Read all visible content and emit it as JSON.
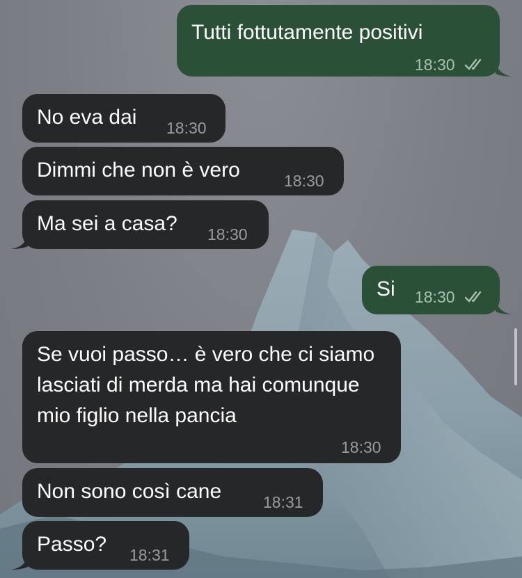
{
  "messages": [
    {
      "direction": "out",
      "text": "Tutti fottutamente positivi",
      "time": "18:30",
      "status": "read"
    },
    {
      "direction": "in",
      "text": "No eva dai",
      "time": "18:30"
    },
    {
      "direction": "in",
      "text": "Dimmi che non è vero",
      "time": "18:30"
    },
    {
      "direction": "in",
      "text": "Ma sei a casa?",
      "time": "18:30"
    },
    {
      "direction": "out",
      "text": "Si",
      "time": "18:30",
      "status": "read"
    },
    {
      "direction": "in",
      "text": "Se vuoi passo… è vero che ci siamo lasciati di merda ma hai comunque mio figlio nella pancia",
      "time": "18:30"
    },
    {
      "direction": "in",
      "text": "Non sono così cane",
      "time": "18:31"
    },
    {
      "direction": "in",
      "text": "Passo?",
      "time": "18:31"
    }
  ],
  "colors": {
    "incoming_bubble": "#262729",
    "outgoing_bubble": "#2a5138",
    "wallpaper": "#7f8289"
  },
  "icons": {
    "read_status": "double-check-icon"
  }
}
